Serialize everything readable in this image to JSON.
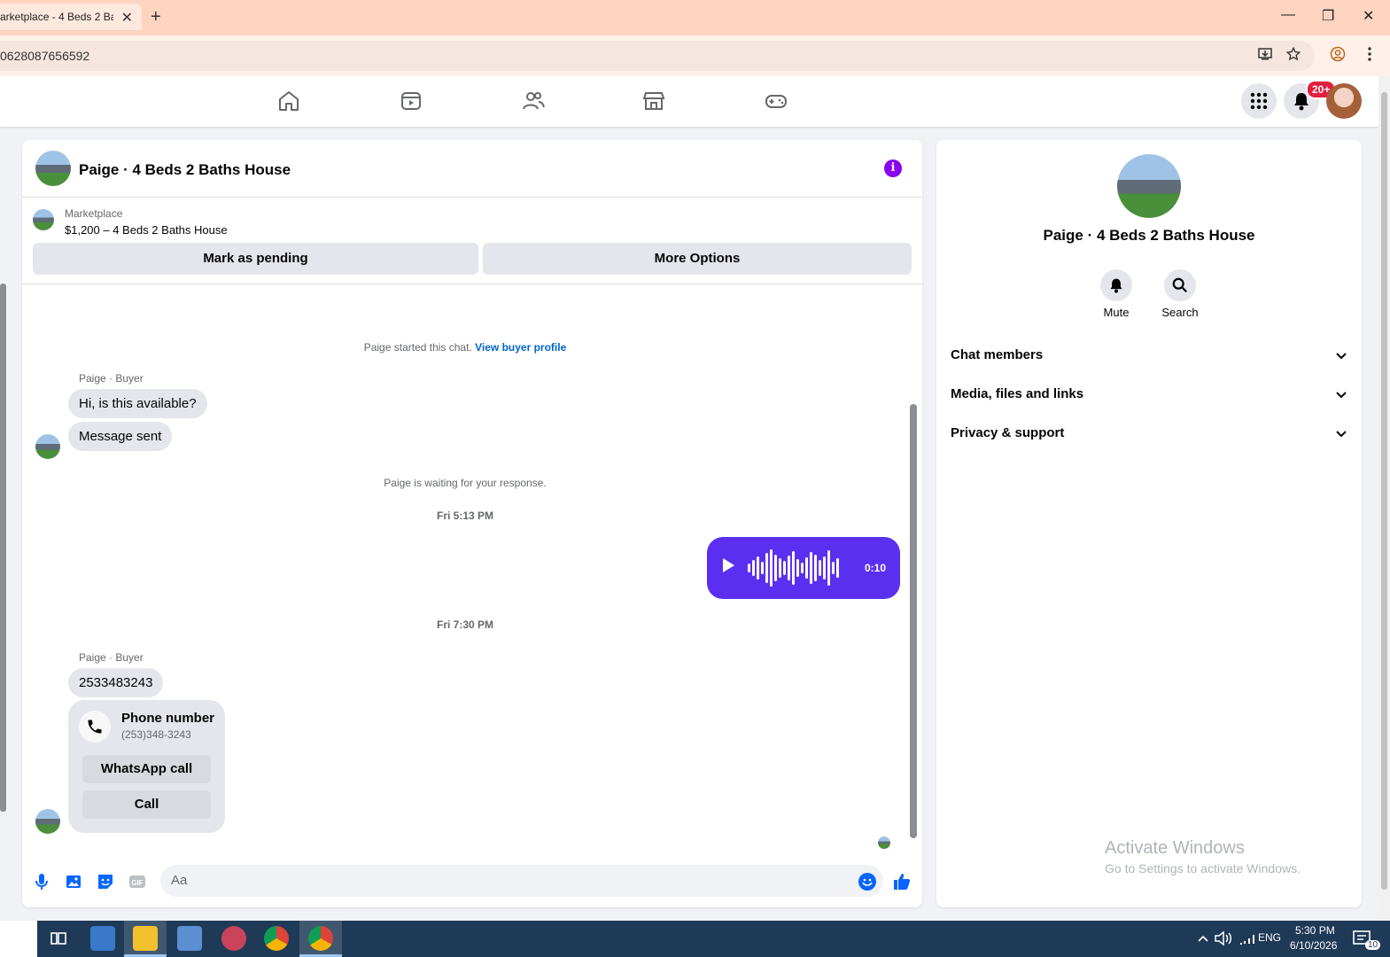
{
  "browser": {
    "tab_title": "arketplace - 4 Beds 2 Ba",
    "new_tab": "+",
    "close_tab": "✕",
    "address": "0628087656592",
    "controls": {
      "minimize": "—",
      "restore": "❐",
      "close": "✕"
    }
  },
  "topnav": {
    "notifications_badge": "20+"
  },
  "chat": {
    "title": "Paige · 4 Beds 2 Baths House",
    "marketplace_label": "Marketplace",
    "listing": "$1,200 – 4 Beds 2 Baths House",
    "mark_pending": "Mark as pending",
    "more_options": "More Options",
    "started_text": "Paige started this chat.",
    "view_profile": "View buyer profile",
    "sender1": "Paige · Buyer",
    "msg1": "Hi, is this available?",
    "msg2": "Message sent",
    "waiting": "Paige is waiting for your response.",
    "time1": "Fri 5:13 PM",
    "voice_duration": "0:10",
    "time2": "Fri 7:30 PM",
    "sender2": "Paige · Buyer",
    "msg3": "2533483243",
    "phone_title": "Phone number",
    "phone_number": "(253)348-3243",
    "whatsapp_call": "WhatsApp call",
    "call": "Call",
    "composer_placeholder": "Aa"
  },
  "right_panel": {
    "name": "Paige · 4 Beds 2 Baths House",
    "mute": "Mute",
    "search": "Search",
    "sections": [
      "Chat members",
      "Media, files and links",
      "Privacy & support"
    ],
    "watermark_title": "Activate Windows",
    "watermark_sub": "Go to Settings to activate Windows."
  },
  "taskbar": {
    "language": "ENG",
    "time": "5:30 PM",
    "date": "6/10/2026",
    "notif_count": "10"
  },
  "colors": {
    "accent": "#5b2ff0",
    "link": "#0064d1",
    "info": "#8a00f0",
    "badge": "#e41e3f"
  }
}
